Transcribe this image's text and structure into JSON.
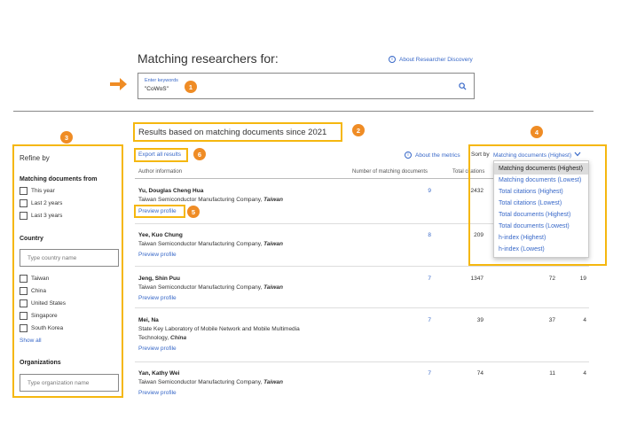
{
  "header": {
    "title": "Matching researchers for:",
    "about_link": "About Researcher Discovery"
  },
  "search": {
    "label": "Enter keywords",
    "value": "\"CoWoS\""
  },
  "results_heading": "Results based on matching documents since 2021",
  "toolbar": {
    "export_label": "Export all results",
    "about_metrics": "About the metrics",
    "sort_by_label": "Sort by",
    "sort_value": "Matching documents (Highest)"
  },
  "columns": {
    "author": "Author information",
    "matching": "Number of matching documents",
    "citations": "Total citations"
  },
  "sort_options": [
    "Matching documents (Highest)",
    "Matching documents (Lowest)",
    "Total citations (Highest)",
    "Total citations (Lowest)",
    "Total documents (Highest)",
    "Total documents (Lowest)",
    "h-index (Highest)",
    "h-index (Lowest)"
  ],
  "refine": {
    "title": "Refine by",
    "matching_docs_title": "Matching documents from",
    "time_options": [
      "This year",
      "Last 2 years",
      "Last 3 years"
    ],
    "country_title": "Country",
    "country_placeholder": "Type country name",
    "countries": [
      "Taiwan",
      "China",
      "United States",
      "Singapore",
      "South Korea"
    ],
    "show_all": "Show all",
    "org_title": "Organizations",
    "org_placeholder": "Type organization name"
  },
  "results": [
    {
      "name": "Yu, Douglas Cheng Hua",
      "aff": "Taiwan Semiconductor Manufacturing Company,",
      "country": "Taiwan",
      "matching": "9",
      "citations": "2432",
      "docs": "",
      "h": "",
      "link": "Preview profile"
    },
    {
      "name": "Yee, Kuo Chung",
      "aff": "Taiwan Semiconductor Manufacturing Company,",
      "country": "Taiwan",
      "matching": "8",
      "citations": "209",
      "docs": "",
      "h": "",
      "link": "Preview profile"
    },
    {
      "name": "Jeng, Shin Puu",
      "aff": "Taiwan Semiconductor Manufacturing Company,",
      "country": "Taiwan",
      "matching": "7",
      "citations": "1347",
      "docs": "72",
      "h": "19",
      "link": "Preview profile"
    },
    {
      "name": "Mei, Na",
      "aff": "State Key Laboratory of Mobile Network and Mobile Multimedia Technology,",
      "country": "China",
      "matching": "7",
      "citations": "39",
      "docs": "37",
      "h": "4",
      "link": "Preview profile"
    },
    {
      "name": "Yan, Kathy Wei",
      "aff": "Taiwan Semiconductor Manufacturing Company,",
      "country": "Taiwan",
      "matching": "7",
      "citations": "74",
      "docs": "11",
      "h": "4",
      "link": "Preview profile"
    }
  ],
  "badges": [
    "1",
    "2",
    "3",
    "4",
    "5",
    "6"
  ],
  "colors": {
    "accent": "#3868c8",
    "highlight": "#f5b70f",
    "badge": "#ef8c25"
  }
}
